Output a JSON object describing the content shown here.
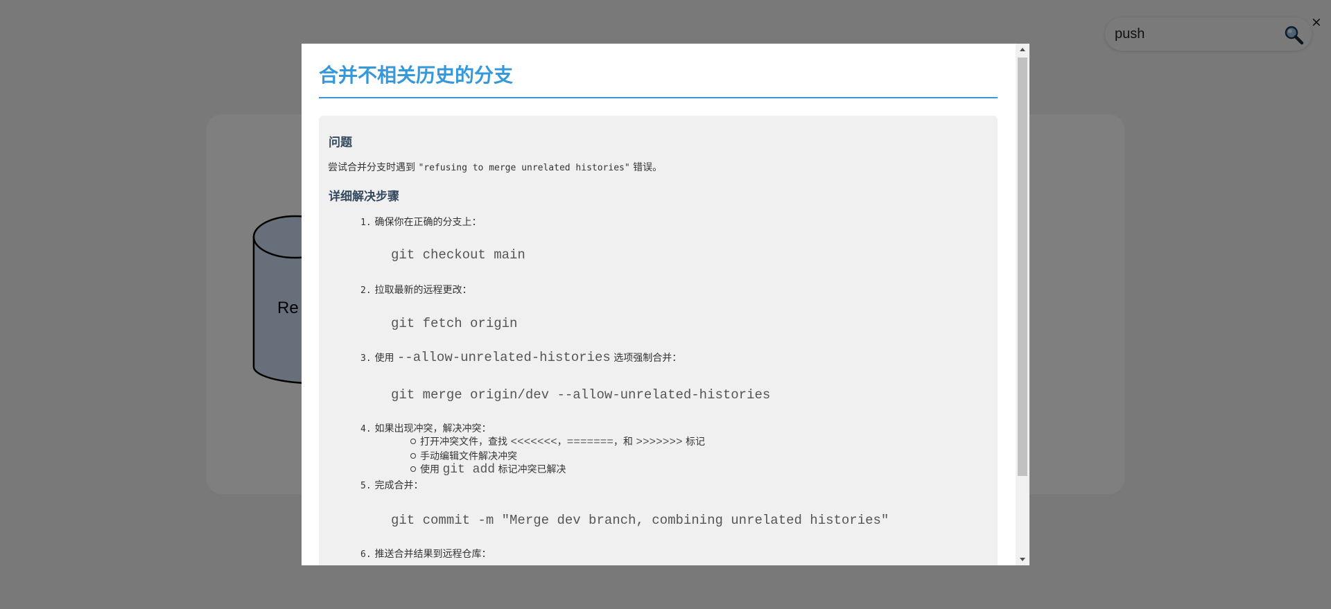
{
  "background": {
    "diagram_label": "Re"
  },
  "search": {
    "value": "push",
    "close_label": "×"
  },
  "modal": {
    "title": "合并不相关历史的分支",
    "problem_heading": "问题",
    "problem_text_pre": "尝试合并分支时遇到 ",
    "problem_error": "\"refusing to merge unrelated histories\"",
    "problem_text_post": " 错误。",
    "steps_heading": "详细解决步骤",
    "steps": [
      {
        "num": "1.",
        "text": "确保你在正确的分支上：",
        "code": "git checkout main"
      },
      {
        "num": "2.",
        "text": "拉取最新的远程更改：",
        "code": "git fetch origin"
      },
      {
        "num": "3.",
        "text_pre": "使用 ",
        "inline_code": "--allow-unrelated-histories",
        "text_post": " 选项强制合并：",
        "code": "git merge origin/dev --allow-unrelated-histories"
      },
      {
        "num": "4.",
        "text": "如果出现冲突，解决冲突："
      },
      {
        "num": "5.",
        "text": "完成合并：",
        "code": "git commit -m \"Merge dev branch, combining unrelated histories\""
      },
      {
        "num": "6.",
        "text": "推送合并结果到远程仓库："
      }
    ],
    "conflict_substeps": {
      "item1_pre": "打开冲突文件，查找 ",
      "item1_code1": "<<<<<<<",
      "item1_sep1": "，",
      "item1_code2": "=======",
      "item1_sep2": "，和 ",
      "item1_code3": ">>>>>>>",
      "item1_post": " 标记",
      "item2": "手动编辑文件解决冲突",
      "item3_pre": "使用 ",
      "item3_code": "git add",
      "item3_post": " 标记冲突已解决"
    }
  },
  "colors": {
    "accent": "#3498db",
    "heading": "#34495e",
    "code": "#555555",
    "content_bg": "#f0f0f0",
    "overlay": "rgba(0,0,0,0.5)"
  }
}
